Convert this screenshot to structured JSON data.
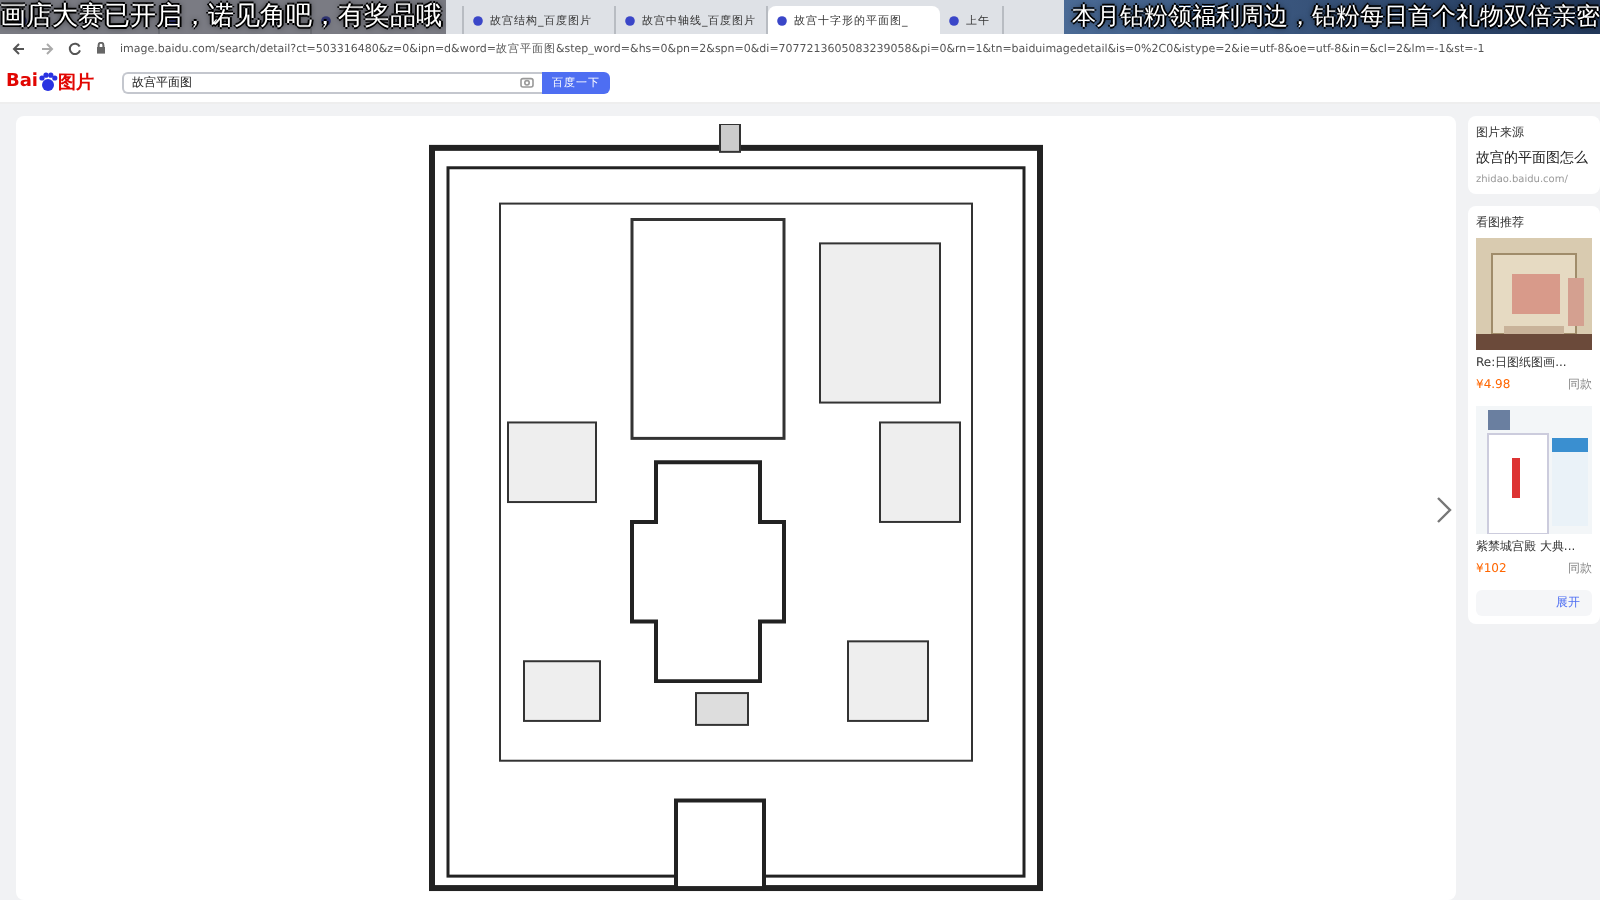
{
  "overlay": {
    "messages": [
      "画店大赛已开启，诺见角吧，有奖品哦",
      "本月钻粉领福利周边，钻粉每日首个礼物双倍亲密"
    ]
  },
  "browser": {
    "tabs": [
      {
        "selected": false
      },
      {
        "selected": false
      },
      {
        "selected": false
      },
      {
        "title": "故宫结构_百度图片",
        "selected": false
      },
      {
        "title": "故宫中轴线_百度图片",
        "selected": false
      },
      {
        "title": "故宫十字形的平面图_",
        "selected": true
      },
      {
        "title": "上午",
        "selected": false
      }
    ],
    "address": "image.baidu.com/search/detail?ct=503316480&z=0&ipn=d&word=故宫平面图&step_word=&hs=0&pn=2&spn=0&di=7077213605083239058&pi=0&rn=1&tn=baiduimagedetail&is=0%2C0&istype=2&ie=utf-8&oe=utf-8&in=&cl=2&lm=-1&st=-1"
  },
  "header": {
    "logo_text": "Bai",
    "logo_suffix": "图片",
    "search": "故宫平面图",
    "button": "百度一下"
  },
  "sidebar": {
    "source": {
      "label": "图片来源",
      "title": "故宫的平面图怎么",
      "url": "zhidao.baidu.com/"
    },
    "recommend": {
      "label": "看图推荐",
      "items": [
        {
          "title": "Re:日图纸图画...",
          "price": "¥4.98",
          "action": "同款"
        },
        {
          "title": "紫禁城宫殿 大典...",
          "price": "¥102",
          "action": "同款"
        }
      ]
    },
    "more": "展开"
  }
}
